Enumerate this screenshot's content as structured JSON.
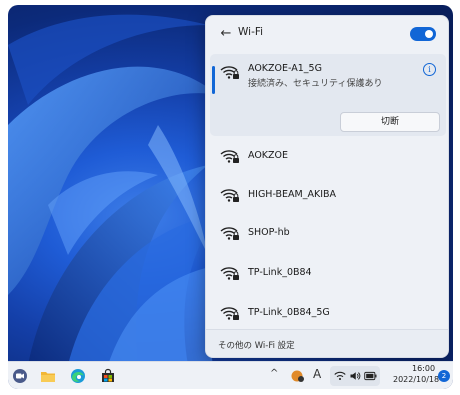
{
  "wifi_panel": {
    "title": "Wi-Fi",
    "back_icon": "arrow-left-icon",
    "toggle_on": true,
    "connected_network": {
      "name": "AOKZOE-A1_5G",
      "status": "接続済み、セキュリティ保護あり",
      "disconnect_label": "切断"
    },
    "networks": [
      {
        "name": "AOKZOE"
      },
      {
        "name": "HIGH-BEAM_AKIBA"
      },
      {
        "name": "SHOP-hb"
      },
      {
        "name": "TP-Link_0B84"
      },
      {
        "name": "TP-Link_0B84_5G"
      }
    ],
    "footer_link": "その他の Wi-Fi 設定"
  },
  "taskbar": {
    "apps": [
      "video-call-icon",
      "file-explorer-icon",
      "edge-browser-icon",
      "store-icon"
    ],
    "tray": {
      "chevron": "^",
      "ime_label": "A",
      "icons": [
        "wifi-icon",
        "volume-icon",
        "battery-icon"
      ]
    },
    "clock": {
      "time": "16:00",
      "date": "2022/10/18"
    },
    "notification_count": "2"
  },
  "colors": {
    "accent": "#1166d6",
    "panel_bg": "#eef1f6"
  }
}
